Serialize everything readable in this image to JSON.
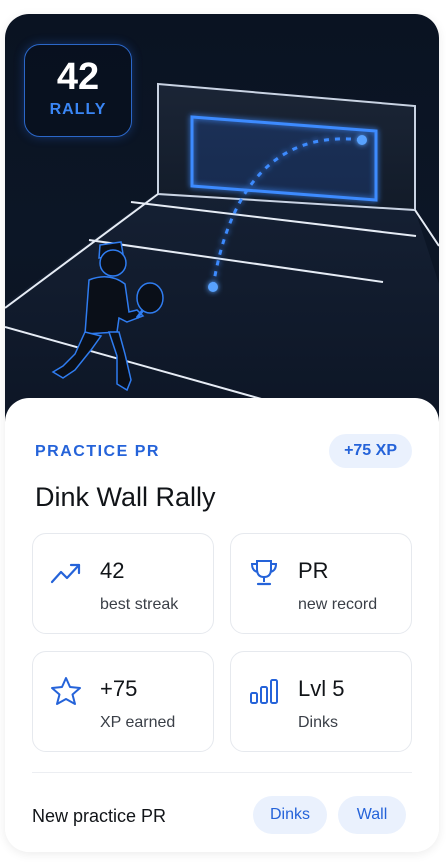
{
  "hero": {
    "rally_count": "42",
    "rally_label": "RALLY"
  },
  "summary": {
    "eyebrow": "PRACTICE PR",
    "xp_badge": "+75 XP",
    "title": "Dink Wall Rally"
  },
  "stats": [
    {
      "icon": "trending-up-icon",
      "value": "42",
      "label": "best streak"
    },
    {
      "icon": "trophy-icon",
      "value": "PR",
      "label": "new record"
    },
    {
      "icon": "star-icon",
      "value": "+75",
      "label": "XP earned"
    },
    {
      "icon": "bar-chart-icon",
      "value": "Lvl 5",
      "label": "Dinks"
    }
  ],
  "footer": {
    "text": "New practice PR",
    "tags": [
      "Dinks",
      "Wall"
    ]
  },
  "colors": {
    "accent": "#2563d9",
    "accent_soft": "#eaf1fd",
    "hero_bg": "#0a1322",
    "glow": "#3a86f4"
  }
}
